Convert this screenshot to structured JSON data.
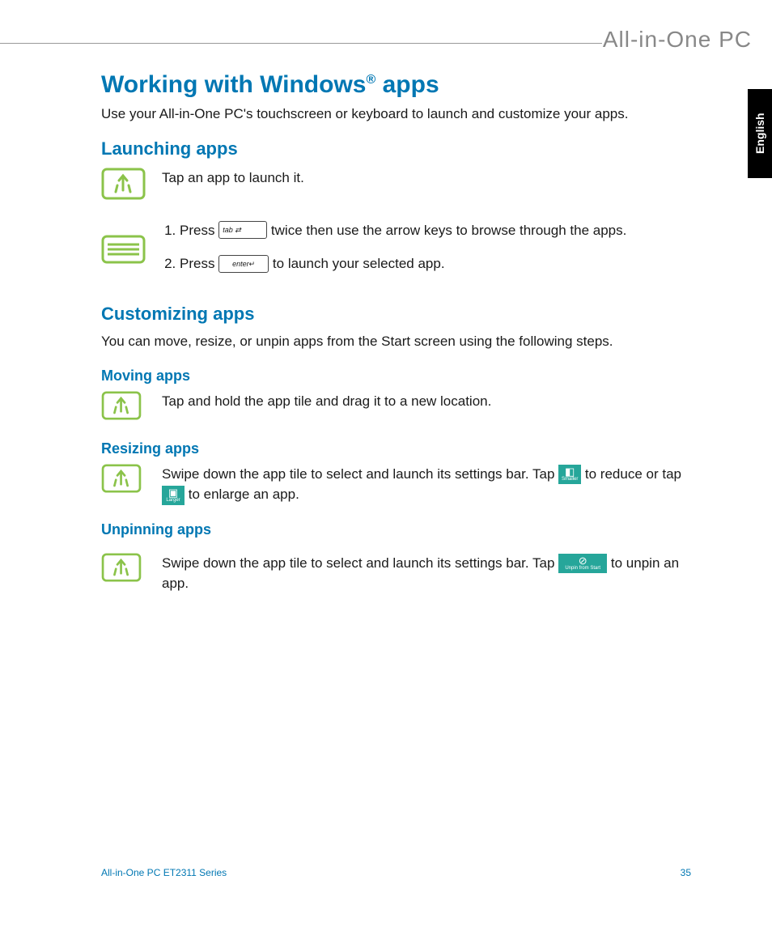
{
  "brand": "All-in-One PC",
  "language_tab": "English",
  "title_pre": "Working with Windows",
  "title_suffix": " apps",
  "intro": "Use your All-in-One PC's touchscreen or keyboard to launch and customize your apps.",
  "launching": {
    "heading": "Launching apps",
    "tap_text": "Tap an app to launch it.",
    "step1_pre": "Press ",
    "step1_post": " twice then use the arrow keys to browse through the apps.",
    "step2_pre": "Press ",
    "step2_post": " to launch your selected app.",
    "key_tab": "tab",
    "key_enter": "enter"
  },
  "customizing": {
    "heading": "Customizing apps",
    "intro": "You can move, resize, or unpin apps from the Start screen using the following steps."
  },
  "moving": {
    "heading": "Moving apps",
    "text": "Tap and hold the app tile and drag it to a new location."
  },
  "resizing": {
    "heading": "Resizing apps",
    "pre": "Swipe down the app tile to select and launch its settings bar. Tap ",
    "mid": " to reduce or tap ",
    "post": " to enlarge an app.",
    "smaller_label": "Smaller",
    "larger_label": "Larger"
  },
  "unpinning": {
    "heading": "Unpinning apps",
    "pre": "Swipe down the app tile to select and launch its settings bar. Tap ",
    "post": " to unpin an app.",
    "unpin_label": "Unpin from Start"
  },
  "footer": {
    "model": "All-in-One PC ET2311 Series",
    "page": "35"
  }
}
